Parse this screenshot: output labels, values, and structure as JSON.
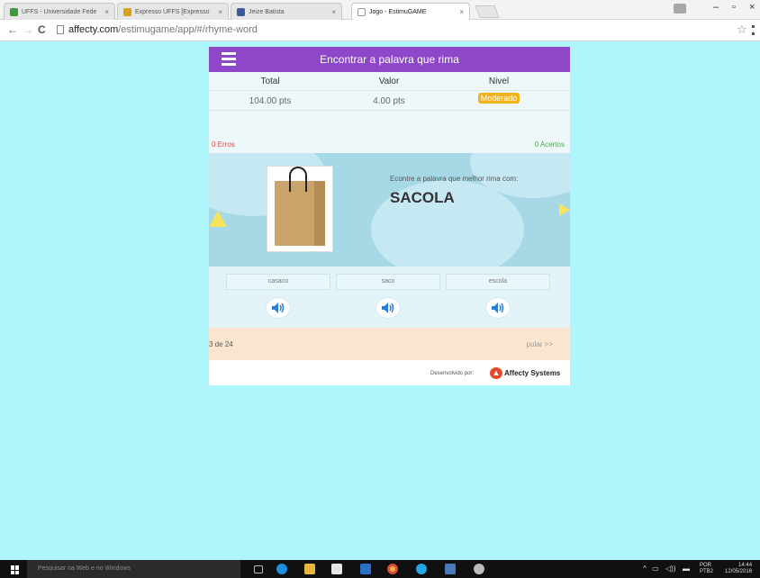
{
  "browser": {
    "tabs": [
      {
        "label": "UFFS - Universidade Fede",
        "favicon_color": "#3c9b3c",
        "active": false
      },
      {
        "label": "Expresso UFFS [Expresso",
        "favicon_color": "#d7a21a",
        "active": false
      },
      {
        "label": "Jeize Batista",
        "favicon_color": "#3b5998",
        "active": false
      },
      {
        "label": "Jogo - EstimuGAME",
        "favicon_color": "#ffffff",
        "active": true
      }
    ],
    "url_domain": "affecty.com",
    "url_path": "/estimugame/app/#/rhyme-word"
  },
  "app": {
    "title": "Encontrar a palavra que rima",
    "header_color": "#8e47c9",
    "stats": {
      "total_label": "Total",
      "total_value": "104.00 pts",
      "valor_label": "Valor",
      "valor_value": "4.00 pts",
      "nivel_label": "Nivel",
      "nivel_value": "Moderado"
    },
    "erros": "0 Erros",
    "acertos": "0 Acertos",
    "image_icon": "paper-bag-icon",
    "prompt": "Econtre a palavra que melhor rima com:",
    "target_word": "SACOLA",
    "options": [
      "casaco",
      "saco",
      "escola"
    ],
    "progress": "3 de 24",
    "skip": "pular >>",
    "footer_devby": "Desenvolvido por:",
    "footer_company": "Affecty Systems"
  },
  "taskbar": {
    "search_placeholder": "Pesquisar na Web e no Windows",
    "lang": "POR",
    "layout": "PTB2",
    "time": "14:44",
    "date": "12/05/2016"
  }
}
